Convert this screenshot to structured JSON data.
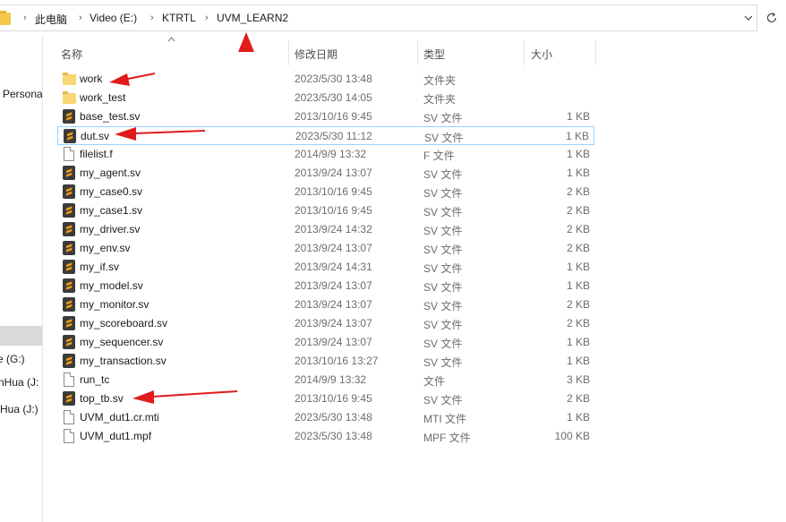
{
  "breadcrumb": {
    "items": [
      "此电脑",
      "Video (E:)",
      "KTRTL",
      "UVM_LEARN2"
    ]
  },
  "nav": {
    "items": [
      "Persona",
      "e (G:)",
      "nHua (J:",
      "Hua (J:)"
    ]
  },
  "columns": {
    "name": "名称",
    "date": "修改日期",
    "type": "类型",
    "size": "大小"
  },
  "files": [
    {
      "name": "work",
      "date": "2023/5/30 13:48",
      "type": "文件夹",
      "size": "",
      "icon": "folder-icon"
    },
    {
      "name": "work_test",
      "date": "2023/5/30 14:05",
      "type": "文件夹",
      "size": "",
      "icon": "folder-icon"
    },
    {
      "name": "base_test.sv",
      "date": "2013/10/16 9:45",
      "type": "SV 文件",
      "size": "1 KB",
      "icon": "sv-file-icon"
    },
    {
      "name": "dut.sv",
      "date": "2023/5/30 11:12",
      "type": "SV 文件",
      "size": "1 KB",
      "icon": "sv-file-icon"
    },
    {
      "name": "filelist.f",
      "date": "2014/9/9 13:32",
      "type": "F 文件",
      "size": "1 KB",
      "icon": "file-icon"
    },
    {
      "name": "my_agent.sv",
      "date": "2013/9/24 13:07",
      "type": "SV 文件",
      "size": "1 KB",
      "icon": "sv-file-icon"
    },
    {
      "name": "my_case0.sv",
      "date": "2013/10/16 9:45",
      "type": "SV 文件",
      "size": "2 KB",
      "icon": "sv-file-icon"
    },
    {
      "name": "my_case1.sv",
      "date": "2013/10/16 9:45",
      "type": "SV 文件",
      "size": "2 KB",
      "icon": "sv-file-icon"
    },
    {
      "name": "my_driver.sv",
      "date": "2013/9/24 14:32",
      "type": "SV 文件",
      "size": "2 KB",
      "icon": "sv-file-icon"
    },
    {
      "name": "my_env.sv",
      "date": "2013/9/24 13:07",
      "type": "SV 文件",
      "size": "2 KB",
      "icon": "sv-file-icon"
    },
    {
      "name": "my_if.sv",
      "date": "2013/9/24 14:31",
      "type": "SV 文件",
      "size": "1 KB",
      "icon": "sv-file-icon"
    },
    {
      "name": "my_model.sv",
      "date": "2013/9/24 13:07",
      "type": "SV 文件",
      "size": "1 KB",
      "icon": "sv-file-icon"
    },
    {
      "name": "my_monitor.sv",
      "date": "2013/9/24 13:07",
      "type": "SV 文件",
      "size": "2 KB",
      "icon": "sv-file-icon"
    },
    {
      "name": "my_scoreboard.sv",
      "date": "2013/9/24 13:07",
      "type": "SV 文件",
      "size": "2 KB",
      "icon": "sv-file-icon"
    },
    {
      "name": "my_sequencer.sv",
      "date": "2013/9/24 13:07",
      "type": "SV 文件",
      "size": "1 KB",
      "icon": "sv-file-icon"
    },
    {
      "name": "my_transaction.sv",
      "date": "2013/10/16 13:27",
      "type": "SV 文件",
      "size": "1 KB",
      "icon": "sv-file-icon"
    },
    {
      "name": "run_tc",
      "date": "2014/9/9 13:32",
      "type": "文件",
      "size": "3 KB",
      "icon": "file-icon"
    },
    {
      "name": "top_tb.sv",
      "date": "2013/10/16 9:45",
      "type": "SV 文件",
      "size": "2 KB",
      "icon": "sv-file-icon"
    },
    {
      "name": "UVM_dut1.cr.mti",
      "date": "2023/5/30 13:48",
      "type": "MTI 文件",
      "size": "1 KB",
      "icon": "file-icon"
    },
    {
      "name": "UVM_dut1.mpf",
      "date": "2023/5/30 13:48",
      "type": "MPF 文件",
      "size": "100 KB",
      "icon": "file-icon"
    }
  ],
  "selected_file": "dut.sv",
  "colors": {
    "annotation_arrow": "#e01b1b",
    "selection_border": "#99d1ff",
    "folder": "#f8d775",
    "sv_icon_bg": "#3b3b3b",
    "sv_icon_s": "#f39c12"
  }
}
